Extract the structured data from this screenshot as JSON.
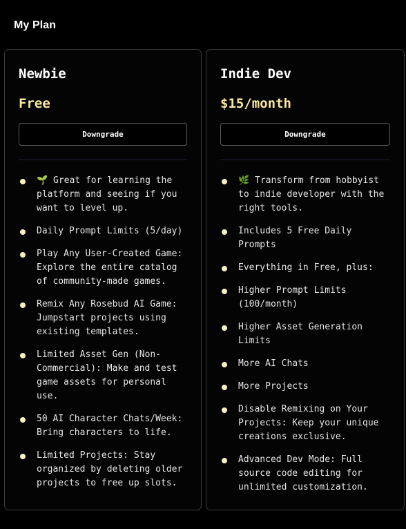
{
  "page": {
    "title": "My Plan"
  },
  "plans": [
    {
      "name": "Newbie",
      "price": "Free",
      "button_label": "Downgrade",
      "features": [
        "🌱 Great for learning the platform and seeing if you want to level up.",
        "Daily Prompt Limits (5/day)",
        "Play Any User-Created Game: Explore the entire catalog of community-made games.",
        "Remix Any Rosebud AI Game: Jumpstart projects using existing templates.",
        "Limited Asset Gen (Non-Commercial): Make and test game assets for personal use.",
        "50 AI Character Chats/Week: Bring characters to life.",
        "Limited Projects: Stay organized by deleting older projects to free up slots."
      ]
    },
    {
      "name": "Indie Dev",
      "price": "$15/month",
      "button_label": "Downgrade",
      "features": [
        "🌿 Transform from hobbyist to indie developer with the right tools.",
        "Includes 5 Free Daily Prompts",
        "Everything in Free, plus:",
        "Higher Prompt Limits (100/month)",
        "Higher Asset Generation Limits",
        "More AI Chats",
        "More Projects",
        "Disable Remixing on Your Projects: Keep your unique creations exclusive.",
        "Advanced Dev Mode: Full source code editing for unlimited customization."
      ]
    }
  ],
  "colors": {
    "background": "#000000",
    "price": "#fbeaa0",
    "bullet": "#f6f2c2",
    "card_border": "#3a3a3a"
  },
  "icons": {
    "feature_bullet": "bullet-dot-icon"
  }
}
